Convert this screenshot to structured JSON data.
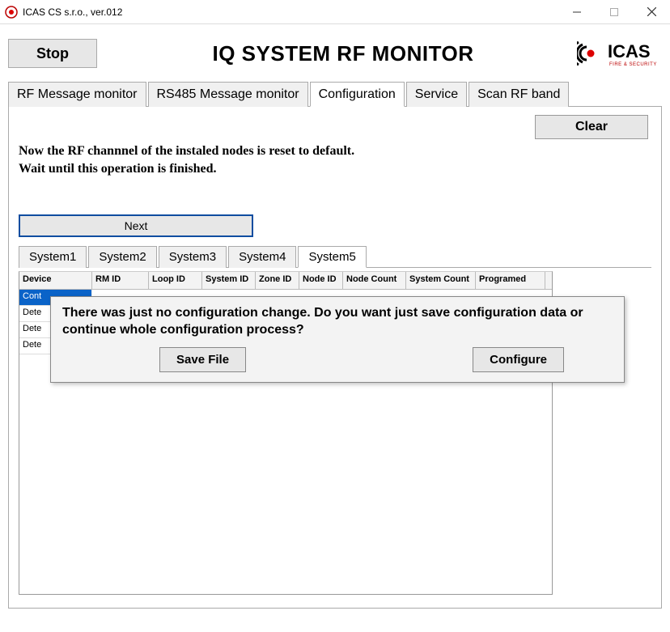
{
  "window": {
    "title": "ICAS CS s.r.o., ver.012"
  },
  "header": {
    "stop": "Stop",
    "title": "IQ SYSTEM RF MONITOR",
    "logo_text": "ICAS",
    "logo_sub": "FIRE & SECURITY"
  },
  "main_tabs": [
    "RF Message monitor",
    "RS485 Message monitor",
    "Configuration",
    "Service",
    "Scan RF band"
  ],
  "main_tab_active": 2,
  "panel": {
    "clear": "Clear",
    "message_line1": "Now the RF channnel of the instaled nodes is reset to default.",
    "message_line2": "Wait until this operation is finished.",
    "next": "Next"
  },
  "system_tabs": [
    "System1",
    "System2",
    "System3",
    "System4",
    "System5"
  ],
  "system_tab_active": 4,
  "grid": {
    "columns": [
      "Device",
      "RM ID",
      "Loop ID",
      "System ID",
      "Zone ID",
      "Node ID",
      "Node Count",
      "System Count",
      "Programed"
    ],
    "rows": [
      {
        "device": "Cont",
        "selected": true
      },
      {
        "device": "Dete"
      },
      {
        "device": "Dete"
      },
      {
        "device": "Dete"
      }
    ]
  },
  "dialog": {
    "text": "There was just no configuration change. Do you want just save configuration data or continue whole configuration process?",
    "save": "Save File",
    "configure": "Configure"
  }
}
